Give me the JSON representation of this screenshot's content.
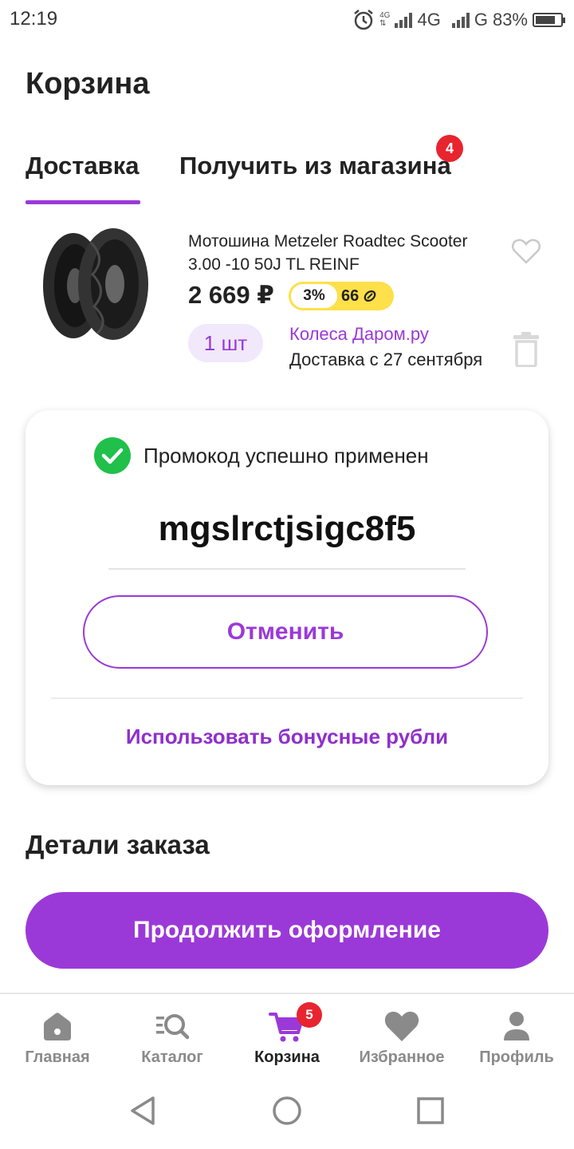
{
  "status_bar": {
    "time": "12:19",
    "net1": "4G",
    "net2": "4G",
    "net3": "G",
    "battery": "83%"
  },
  "page": {
    "title": "Корзина"
  },
  "tabs": [
    {
      "label": "Доставка",
      "active": true
    },
    {
      "label": "Получить из магазина",
      "badge": "4"
    }
  ],
  "product": {
    "name": "Мотошина Metzeler Roadtec Scooter 3.00 -10 50J TL REINF",
    "price": "2 669 ₽",
    "bonus_percent": "3%",
    "bonus_value": "66",
    "quantity": "1 шт",
    "seller": "Колеса Даром.ру",
    "delivery": "Доставка с 27 сентября"
  },
  "promo": {
    "status": "Промокод успешно применен",
    "code": "mgslrctjsigc8f5",
    "cancel_label": "Отменить",
    "use_bonus_label": "Использовать бонусные рубли"
  },
  "order": {
    "section_title": "Детали заказа",
    "continue_label": "Продолжить оформление"
  },
  "bottom_nav": [
    {
      "label": "Главная",
      "icon": "home-icon"
    },
    {
      "label": "Каталог",
      "icon": "catalog-search-icon"
    },
    {
      "label": "Корзина",
      "icon": "cart-icon",
      "badge": "5",
      "active": true
    },
    {
      "label": "Избранное",
      "icon": "heart-icon"
    },
    {
      "label": "Профиль",
      "icon": "profile-icon"
    }
  ],
  "colors": {
    "accent": "#9b39d8",
    "badge": "#e8242f",
    "success": "#20c04a",
    "bonus": "#fde04a"
  }
}
